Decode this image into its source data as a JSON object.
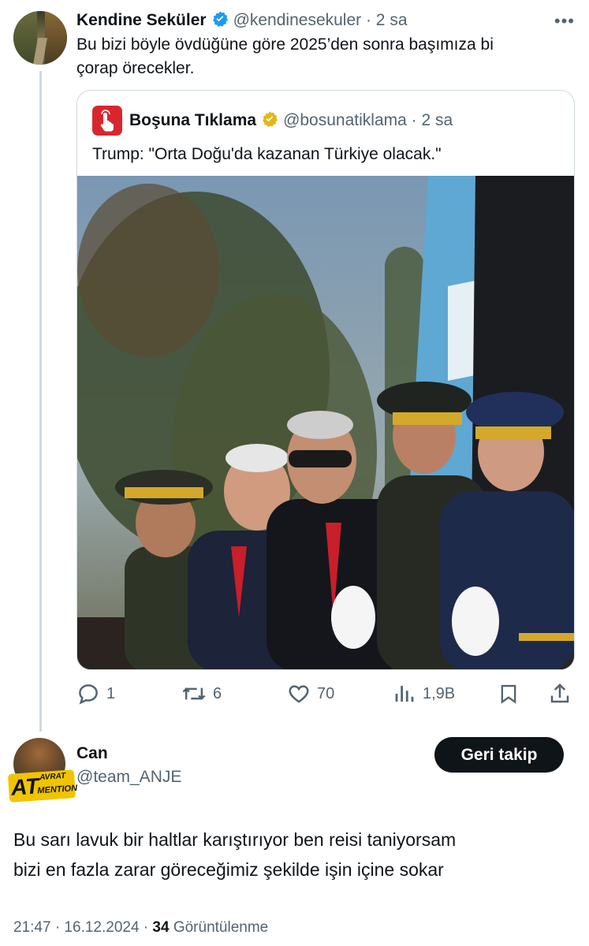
{
  "parent_tweet": {
    "display_name": "Kendine Seküler",
    "handle": "@kendinesekuler",
    "time": "· 2 sa",
    "text_line1": "Bu bizi böyle övdüğüne göre 2025’den sonra başımıza bi",
    "text_line2": "çorap örecekler.",
    "more_icon": "ellipsis-icon",
    "quoted": {
      "display_name": "Boşuna Tıklama",
      "handle": "@bosunatiklama",
      "time": "· 2 sa",
      "text": "Trump: \"Orta Doğu'da kazanan Türkiye olacak.\"",
      "image_description_icon": "photo"
    },
    "stats": {
      "replies": "1",
      "reposts": "6",
      "likes": "70",
      "views": "1,9B"
    }
  },
  "reply_tweet": {
    "display_name": "Can",
    "handle": "@team_ANJE",
    "follow_label": "Geri takip",
    "badge_text_main": "AT",
    "badge_text_top": "AVRAT",
    "badge_text_bottom": "MENTION",
    "text_line1": "Bu sarı lavuk bir haltlar karıştırıyor ben reisi taniyorsam",
    "text_line2": "bizi en fazla zarar göreceğimiz şekilde işin içine sokar",
    "meta_time": "21:47 · 16.12.2024 · ",
    "meta_views_count": "34",
    "meta_views_label": " Görüntülenme"
  },
  "colors": {
    "verified_blue": "#1d9bf0",
    "verified_gold": "#e2b719",
    "muted": "#536471",
    "brand_red": "#d8262f"
  }
}
